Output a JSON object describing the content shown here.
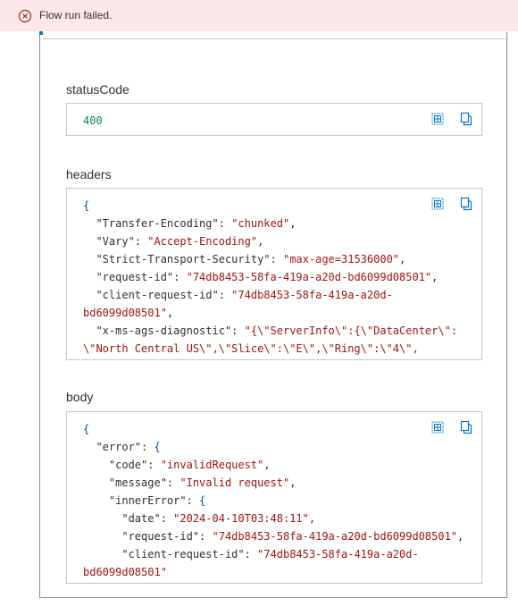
{
  "banner": {
    "message": "Flow run failed.",
    "icon": "error-circle-icon",
    "background": "#fde7e9",
    "icon_color": "#a4262c"
  },
  "sections": {
    "status": {
      "label": "statusCode",
      "value": "400"
    },
    "headers": {
      "label": "headers",
      "lines": [
        {
          "t": "{"
        },
        {
          "k": "  \"Transfer-Encoding\"",
          "v": "\"chunked\"",
          "e": ","
        },
        {
          "k": "  \"Vary\"",
          "v": "\"Accept-Encoding\"",
          "e": ","
        },
        {
          "k": "  \"Strict-Transport-Security\"",
          "v": "\"max-age=31536000\"",
          "e": ","
        },
        {
          "k": "  \"request-id\"",
          "v": "\"74db8453-58fa-419a-a20d-bd6099d08501\"",
          "e": ","
        },
        {
          "k": "  \"client-request-id\"",
          "v": "\"74db8453-58fa-419a-a20d-",
          "e": ""
        },
        {
          "c": "bd6099d08501\"",
          "e": ","
        },
        {
          "k": "  \"x-ms-ags-diagnostic\"",
          "v": "\"{\\\"ServerInfo\\\":{\\\"DataCenter\\\":",
          "e": ""
        },
        {
          "c": "\\\"North Central US\\\",\\\"Slice\\\":\\\"E\\\",\\\"Ring\\\":\\\"4\\\",",
          "e": ""
        }
      ]
    },
    "body": {
      "label": "body",
      "lines": [
        {
          "t": "{"
        },
        {
          "k": "  \"error\"",
          "o": "{"
        },
        {
          "k": "    \"code\"",
          "v": "\"invalidRequest\"",
          "e": ","
        },
        {
          "k": "    \"message\"",
          "v": "\"Invalid request\"",
          "e": ","
        },
        {
          "k": "    \"innerError\"",
          "o": "{"
        },
        {
          "k": "      \"date\"",
          "v": "\"2024-04-10T03:48:11\"",
          "e": ","
        },
        {
          "k": "      \"request-id\"",
          "v": "\"74db8453-58fa-419a-a20d-bd6099d08501\"",
          "e": ","
        },
        {
          "k": "      \"client-request-id\"",
          "v": "\"74db8453-58fa-419a-a20d-",
          "e": ""
        },
        {
          "c": "bd6099d08501\"",
          "e": ""
        }
      ]
    }
  },
  "tools": {
    "expand_icon": "expand-icon",
    "copy_icon": "copy-icon",
    "accent": "#0078d4"
  }
}
